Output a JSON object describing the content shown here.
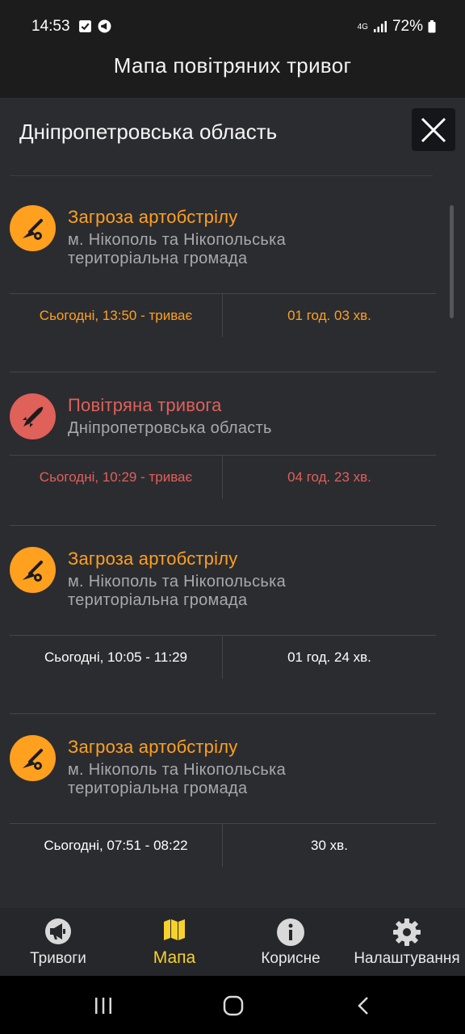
{
  "status_bar": {
    "time": "14:53",
    "network": "4G",
    "battery": "72%"
  },
  "app": {
    "title": "Мапа повітряних тривог"
  },
  "sheet": {
    "region_title": "Дніпропетровська область",
    "alerts": [
      {
        "type": "artillery",
        "title": "Загроза артобстрілу",
        "location_line1": "м. Нікополь та Нікопольська",
        "location_line2": "територіальна громада",
        "time": "Сьогодні, 13:50 - триває",
        "duration": "01 год. 03 хв.",
        "state": "active",
        "color": "#ffa01f"
      },
      {
        "type": "air-raid",
        "title": "Повітряна тривога",
        "location_line1": "Дніпропетровська область",
        "location_line2": "",
        "time": "Сьогодні, 10:29 - триває",
        "duration": "04 год. 23 хв.",
        "state": "active",
        "color": "#e0605a"
      },
      {
        "type": "artillery",
        "title": "Загроза артобстрілу",
        "location_line1": "м. Нікополь та Нікопольська",
        "location_line2": "територіальна громада",
        "time": "Сьогодні, 10:05 - 11:29",
        "duration": "01 год. 24 хв.",
        "state": "ended",
        "color": "#ffa01f"
      },
      {
        "type": "artillery",
        "title": "Загроза артобстрілу",
        "location_line1": "м. Нікополь та Нікопольська",
        "location_line2": "територіальна громада",
        "time": "Сьогодні, 07:51 - 08:22",
        "duration": "30 хв.",
        "state": "ended",
        "color": "#ffa01f"
      }
    ]
  },
  "bottom_nav": {
    "items": [
      {
        "label": "Тривоги",
        "icon": "megaphone-icon",
        "active": false
      },
      {
        "label": "Мапа",
        "icon": "map-icon",
        "active": true
      },
      {
        "label": "Корисне",
        "icon": "info-icon",
        "active": false
      },
      {
        "label": "Налаштування",
        "icon": "gear-icon",
        "active": false
      }
    ]
  },
  "colors": {
    "accent_active": "#f8d22c",
    "artillery": "#ffa01f",
    "air_raid": "#e0605a"
  }
}
